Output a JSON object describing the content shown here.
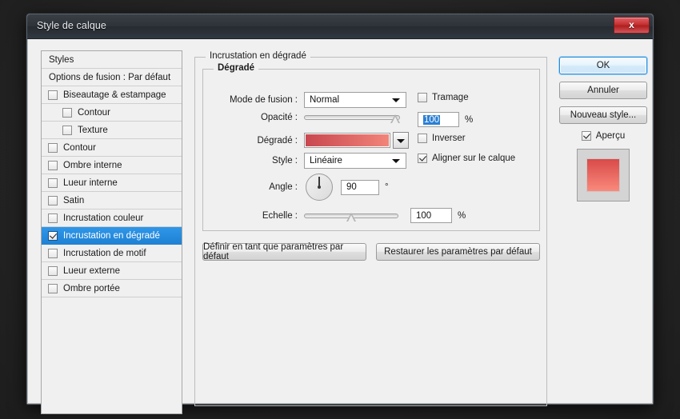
{
  "window": {
    "title": "Style de calque",
    "close_label": "x"
  },
  "styles_list": {
    "header": "Styles",
    "blending_options": "Options de fusion : Par défaut",
    "items": [
      {
        "label": "Biseautage & estampage",
        "checked": false,
        "indent": false,
        "selected": false
      },
      {
        "label": "Contour",
        "checked": false,
        "indent": true,
        "selected": false
      },
      {
        "label": "Texture",
        "checked": false,
        "indent": true,
        "selected": false
      },
      {
        "label": "Contour",
        "checked": false,
        "indent": false,
        "selected": false
      },
      {
        "label": "Ombre interne",
        "checked": false,
        "indent": false,
        "selected": false
      },
      {
        "label": "Lueur interne",
        "checked": false,
        "indent": false,
        "selected": false
      },
      {
        "label": "Satin",
        "checked": false,
        "indent": false,
        "selected": false
      },
      {
        "label": "Incrustation couleur",
        "checked": false,
        "indent": false,
        "selected": false
      },
      {
        "label": "Incrustation en dégradé",
        "checked": true,
        "indent": false,
        "selected": true
      },
      {
        "label": "Incrustation de motif",
        "checked": false,
        "indent": false,
        "selected": false
      },
      {
        "label": "Lueur externe",
        "checked": false,
        "indent": false,
        "selected": false
      },
      {
        "label": "Ombre portée",
        "checked": false,
        "indent": false,
        "selected": false
      }
    ]
  },
  "panel": {
    "title": "Incrustation en dégradé",
    "group_title": "Dégradé",
    "blend_mode": {
      "label": "Mode de fusion :",
      "value": "Normal"
    },
    "opacity": {
      "label": "Opacité :",
      "value": "100",
      "unit": "%",
      "percent": 100
    },
    "gradient": {
      "label": "Dégradé :",
      "color_start": "#c8474f",
      "color_end": "#f2857a"
    },
    "style": {
      "label": "Style :",
      "value": "Linéaire"
    },
    "angle": {
      "label": "Angle :",
      "value": "90",
      "unit": "°"
    },
    "scale": {
      "label": "Echelle :",
      "value": "100",
      "unit": "%",
      "percent": 50
    },
    "dither": {
      "label": "Tramage",
      "checked": false
    },
    "reverse": {
      "label": "Inverser",
      "checked": false
    },
    "align_layer": {
      "label": "Aligner sur le calque",
      "checked": true
    },
    "set_default_button": "Définir en tant que paramètres par défaut",
    "restore_default_button": "Restaurer les paramètres par défaut"
  },
  "actions": {
    "ok": "OK",
    "cancel": "Annuler",
    "new_style": "Nouveau style...",
    "preview": {
      "label": "Aperçu",
      "checked": true
    },
    "preview_swatch_start": "#d94a48",
    "preview_swatch_end": "#fa8a7c"
  }
}
